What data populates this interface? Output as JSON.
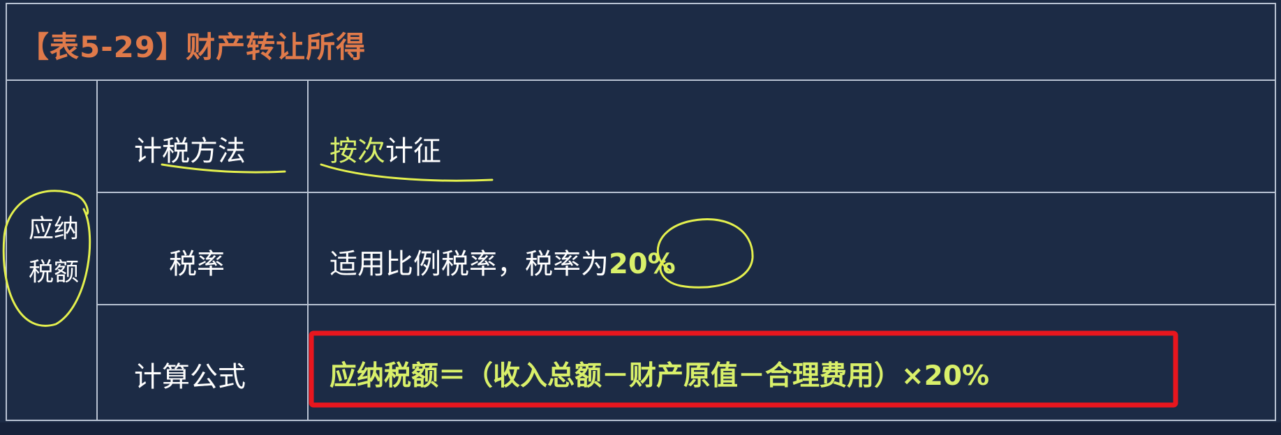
{
  "table": {
    "title": "【表5-29】财产转让所得",
    "group_label_line1": "应纳",
    "group_label_line2": "税额",
    "rows": [
      {
        "label": "计税方法",
        "value_highlight": "按次",
        "value_rest": "计征"
      },
      {
        "label": "税率",
        "value_text": "适用比例税率，税率为",
        "value_highlight": "20%"
      },
      {
        "label": "计算公式",
        "formula": "应纳税额＝（收入总额－财产原值－合理费用）×20%"
      }
    ]
  },
  "colors": {
    "background": "#1c2b45",
    "border": "#b9c3d3",
    "title": "#e07a4a",
    "accent": "#d9f06a",
    "annotation_marker": "#e4f04e",
    "highlight_box": "#e8161e"
  }
}
